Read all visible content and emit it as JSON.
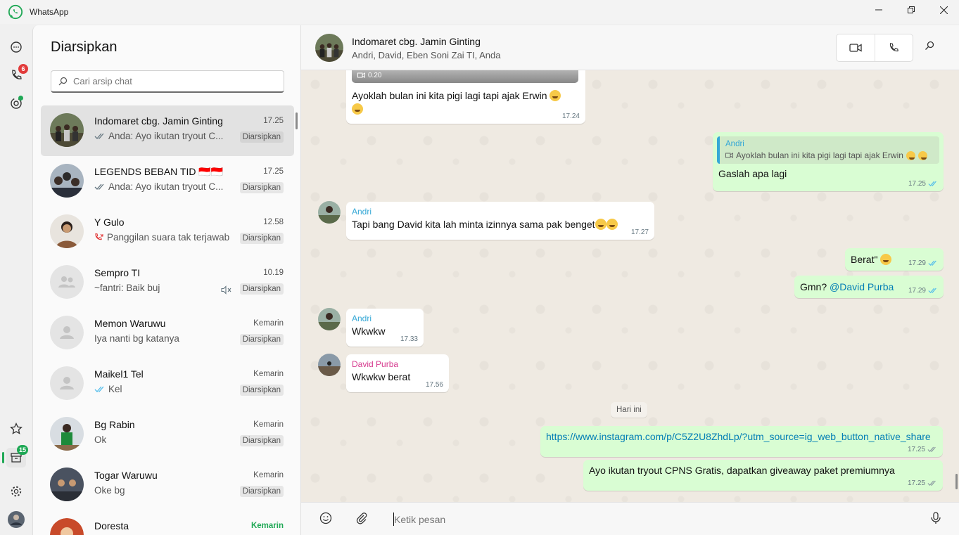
{
  "app": {
    "title": "WhatsApp",
    "accent": "#1fa855"
  },
  "rail": {
    "calls_badge": "6",
    "archived_badge": "15"
  },
  "sidebar": {
    "title": "Diarsipkan",
    "search_placeholder": "Cari arsip chat",
    "chats": [
      {
        "name": "Indomaret cbg. Jamin Ginting",
        "time": "17.25",
        "preview": "Anda: Ayo ikutan tryout C...",
        "tag": "Diarsipkan"
      },
      {
        "name": "LEGENDS BEBAN TID 🇮🇩🇮🇩",
        "time": "17.25",
        "preview": "Anda: Ayo ikutan tryout C...",
        "tag": "Diarsipkan"
      },
      {
        "name": "Y Gulo",
        "time": "12.58",
        "preview": "Panggilan suara tak terjawab",
        "tag": "Diarsipkan"
      },
      {
        "name": "Sempro TI",
        "time": "10.19",
        "preview": "~fantri: Baik buj",
        "tag": "Diarsipkan"
      },
      {
        "name": "Memon Waruwu",
        "time": "Kemarin",
        "preview": "Iya nanti bg katanya",
        "tag": "Diarsipkan"
      },
      {
        "name": "Maikel1 Tel",
        "time": "Kemarin",
        "preview": "Kel",
        "tag": "Diarsipkan"
      },
      {
        "name": "Bg Rabin",
        "time": "Kemarin",
        "preview": "Ok",
        "tag": "Diarsipkan"
      },
      {
        "name": "Togar Waruwu",
        "time": "Kemarin",
        "preview": "Oke bg",
        "tag": "Diarsipkan"
      },
      {
        "name": "Doresta",
        "time": "Kemarin",
        "preview": "",
        "tag": ""
      }
    ]
  },
  "chat": {
    "title": "Indomaret cbg. Jamin Ginting",
    "members": "Andri, David, Eben Soni Zai TI, Anda",
    "messages": {
      "video_duration": "0.20",
      "m1_text": "Ayoklah bulan ini kita pigi lagi tapi ajak Erwin",
      "m1_time": "17.24",
      "m2_quote_name": "Andri",
      "m2_quote_text": "Ayoklah bulan ini kita pigi lagi tapi ajak Erwin",
      "m2_text": "Gaslah apa lagi",
      "m2_time": "17.25",
      "m3_sender": "Andri",
      "m3_text": "Tapi bang David kita lah minta izinnya sama pak benget",
      "m3_time": "17.27",
      "m4_text": "Berat\"",
      "m4_time": "17.29",
      "m5_text": "Gmn?",
      "m5_mention": "@David Purba",
      "m5_time": "17.29",
      "m6_sender": "Andri",
      "m6_text": "Wkwkw",
      "m6_time": "17.33",
      "m7_sender": "David Purba",
      "m7_text": "Wkwkw berat",
      "m7_time": "17.56",
      "date_pill": "Hari ini",
      "m8_text": "https://www.instagram.com/p/C5Z2U8ZhdLp/?utm_source=ig_web_button_native_share",
      "m8_time": "17.25",
      "m9_text": "Ayo ikutan tryout CPNS Gratis, dapatkan giveaway paket premiumnya",
      "m9_time": "17.25"
    },
    "input_placeholder": "Ketik pesan"
  }
}
